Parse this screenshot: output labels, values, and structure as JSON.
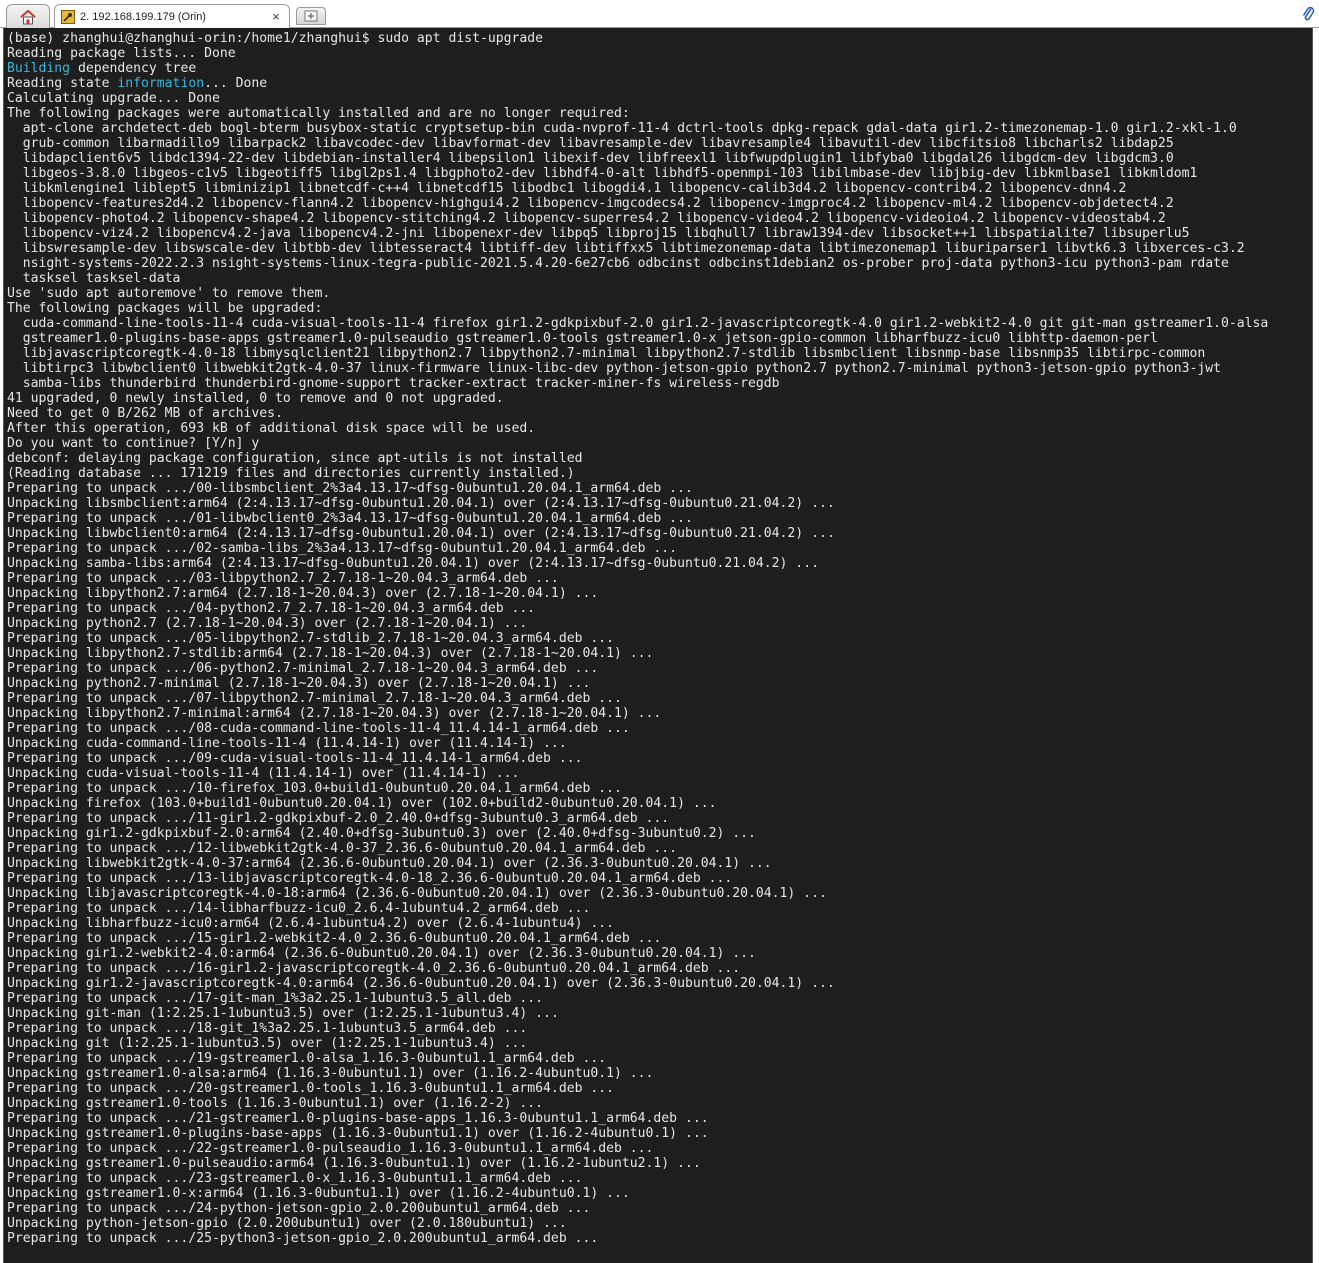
{
  "tabs": {
    "active_title": "2. 192.168.199.179 (Orin)",
    "close_glyph": "×",
    "home_icon": "home-icon",
    "new_tab_icon": "new-tab-icon"
  },
  "colors": {
    "terminal_bg": "#1e1e1e",
    "terminal_fg": "#e6e6e6",
    "highlight": "#3ab7d9"
  },
  "terminal": {
    "lines": [
      "(base) zhanghui@zhanghui-orin:/home1/zhanghui$ sudo apt dist-upgrade",
      "Reading package lists... Done",
      "Building dependency tree",
      "Reading state information... Done",
      "Calculating upgrade... Done",
      "The following packages were automatically installed and are no longer required:",
      "  apt-clone archdetect-deb bogl-bterm busybox-static cryptsetup-bin cuda-nvprof-11-4 dctrl-tools dpkg-repack gdal-data gir1.2-timezonemap-1.0 gir1.2-xkl-1.0",
      "  grub-common libarmadillo9 libarpack2 libavcodec-dev libavformat-dev libavresample-dev libavresample4 libavutil-dev libcfitsio8 libcharls2 libdap25",
      "  libdapclient6v5 libdc1394-22-dev libdebian-installer4 libepsilon1 libexif-dev libfreexl1 libfwupdplugin1 libfyba0 libgdal26 libgdcm-dev libgdcm3.0",
      "  libgeos-3.8.0 libgeos-c1v5 libgeotiff5 libgl2ps1.4 libgphoto2-dev libhdf4-0-alt libhdf5-openmpi-103 libilmbase-dev libjbig-dev libkmlbase1 libkmldom1",
      "  libkmlengine1 liblept5 libminizip1 libnetcdf-c++4 libnetcdf15 libodbc1 libogdi4.1 libopencv-calib3d4.2 libopencv-contrib4.2 libopencv-dnn4.2",
      "  libopencv-features2d4.2 libopencv-flann4.2 libopencv-highgui4.2 libopencv-imgcodecs4.2 libopencv-imgproc4.2 libopencv-ml4.2 libopencv-objdetect4.2",
      "  libopencv-photo4.2 libopencv-shape4.2 libopencv-stitching4.2 libopencv-superres4.2 libopencv-video4.2 libopencv-videoio4.2 libopencv-videostab4.2",
      "  libopencv-viz4.2 libopencv4.2-java libopencv4.2-jni libopenexr-dev libpq5 libproj15 libqhull7 libraw1394-dev libsocket++1 libspatialite7 libsuperlu5",
      "  libswresample-dev libswscale-dev libtbb-dev libtesseract4 libtiff-dev libtiffxx5 libtimezonemap-data libtimezonemap1 liburiparser1 libvtk6.3 libxerces-c3.2",
      "  nsight-systems-2022.2.3 nsight-systems-linux-tegra-public-2021.5.4.20-6e27cb6 odbcinst odbcinst1debian2 os-prober proj-data python3-icu python3-pam rdate",
      "  tasksel tasksel-data",
      "Use 'sudo apt autoremove' to remove them.",
      "The following packages will be upgraded:",
      "  cuda-command-line-tools-11-4 cuda-visual-tools-11-4 firefox gir1.2-gdkpixbuf-2.0 gir1.2-javascriptcoregtk-4.0 gir1.2-webkit2-4.0 git git-man gstreamer1.0-alsa",
      "  gstreamer1.0-plugins-base-apps gstreamer1.0-pulseaudio gstreamer1.0-tools gstreamer1.0-x jetson-gpio-common libharfbuzz-icu0 libhttp-daemon-perl",
      "  libjavascriptcoregtk-4.0-18 libmysqlclient21 libpython2.7 libpython2.7-minimal libpython2.7-stdlib libsmbclient libsnmp-base libsnmp35 libtirpc-common",
      "  libtirpc3 libwbclient0 libwebkit2gtk-4.0-37 linux-firmware linux-libc-dev python-jetson-gpio python2.7 python2.7-minimal python3-jetson-gpio python3-jwt",
      "  samba-libs thunderbird thunderbird-gnome-support tracker-extract tracker-miner-fs wireless-regdb",
      "41 upgraded, 0 newly installed, 0 to remove and 0 not upgraded.",
      "Need to get 0 B/262 MB of archives.",
      "After this operation, 693 kB of additional disk space will be used.",
      "Do you want to continue? [Y/n] y",
      "debconf: delaying package configuration, since apt-utils is not installed",
      "(Reading database ... 171219 files and directories currently installed.)",
      "Preparing to unpack .../00-libsmbclient_2%3a4.13.17~dfsg-0ubuntu1.20.04.1_arm64.deb ...",
      "Unpacking libsmbclient:arm64 (2:4.13.17~dfsg-0ubuntu1.20.04.1) over (2:4.13.17~dfsg-0ubuntu0.21.04.2) ...",
      "Preparing to unpack .../01-libwbclient0_2%3a4.13.17~dfsg-0ubuntu1.20.04.1_arm64.deb ...",
      "Unpacking libwbclient0:arm64 (2:4.13.17~dfsg-0ubuntu1.20.04.1) over (2:4.13.17~dfsg-0ubuntu0.21.04.2) ...",
      "Preparing to unpack .../02-samba-libs_2%3a4.13.17~dfsg-0ubuntu1.20.04.1_arm64.deb ...",
      "Unpacking samba-libs:arm64 (2:4.13.17~dfsg-0ubuntu1.20.04.1) over (2:4.13.17~dfsg-0ubuntu0.21.04.2) ...",
      "Preparing to unpack .../03-libpython2.7_2.7.18-1~20.04.3_arm64.deb ...",
      "Unpacking libpython2.7:arm64 (2.7.18-1~20.04.3) over (2.7.18-1~20.04.1) ...",
      "Preparing to unpack .../04-python2.7_2.7.18-1~20.04.3_arm64.deb ...",
      "Unpacking python2.7 (2.7.18-1~20.04.3) over (2.7.18-1~20.04.1) ...",
      "Preparing to unpack .../05-libpython2.7-stdlib_2.7.18-1~20.04.3_arm64.deb ...",
      "Unpacking libpython2.7-stdlib:arm64 (2.7.18-1~20.04.3) over (2.7.18-1~20.04.1) ...",
      "Preparing to unpack .../06-python2.7-minimal_2.7.18-1~20.04.3_arm64.deb ...",
      "Unpacking python2.7-minimal (2.7.18-1~20.04.3) over (2.7.18-1~20.04.1) ...",
      "Preparing to unpack .../07-libpython2.7-minimal_2.7.18-1~20.04.3_arm64.deb ...",
      "Unpacking libpython2.7-minimal:arm64 (2.7.18-1~20.04.3) over (2.7.18-1~20.04.1) ...",
      "Preparing to unpack .../08-cuda-command-line-tools-11-4_11.4.14-1_arm64.deb ...",
      "Unpacking cuda-command-line-tools-11-4 (11.4.14-1) over (11.4.14-1) ...",
      "Preparing to unpack .../09-cuda-visual-tools-11-4_11.4.14-1_arm64.deb ...",
      "Unpacking cuda-visual-tools-11-4 (11.4.14-1) over (11.4.14-1) ...",
      "Preparing to unpack .../10-firefox_103.0+build1-0ubuntu0.20.04.1_arm64.deb ...",
      "Unpacking firefox (103.0+build1-0ubuntu0.20.04.1) over (102.0+build2-0ubuntu0.20.04.1) ...",
      "Preparing to unpack .../11-gir1.2-gdkpixbuf-2.0_2.40.0+dfsg-3ubuntu0.3_arm64.deb ...",
      "Unpacking gir1.2-gdkpixbuf-2.0:arm64 (2.40.0+dfsg-3ubuntu0.3) over (2.40.0+dfsg-3ubuntu0.2) ...",
      "Preparing to unpack .../12-libwebkit2gtk-4.0-37_2.36.6-0ubuntu0.20.04.1_arm64.deb ...",
      "Unpacking libwebkit2gtk-4.0-37:arm64 (2.36.6-0ubuntu0.20.04.1) over (2.36.3-0ubuntu0.20.04.1) ...",
      "Preparing to unpack .../13-libjavascriptcoregtk-4.0-18_2.36.6-0ubuntu0.20.04.1_arm64.deb ...",
      "Unpacking libjavascriptcoregtk-4.0-18:arm64 (2.36.6-0ubuntu0.20.04.1) over (2.36.3-0ubuntu0.20.04.1) ...",
      "Preparing to unpack .../14-libharfbuzz-icu0_2.6.4-1ubuntu4.2_arm64.deb ...",
      "Unpacking libharfbuzz-icu0:arm64 (2.6.4-1ubuntu4.2) over (2.6.4-1ubuntu4) ...",
      "Preparing to unpack .../15-gir1.2-webkit2-4.0_2.36.6-0ubuntu0.20.04.1_arm64.deb ...",
      "Unpacking gir1.2-webkit2-4.0:arm64 (2.36.6-0ubuntu0.20.04.1) over (2.36.3-0ubuntu0.20.04.1) ...",
      "Preparing to unpack .../16-gir1.2-javascriptcoregtk-4.0_2.36.6-0ubuntu0.20.04.1_arm64.deb ...",
      "Unpacking gir1.2-javascriptcoregtk-4.0:arm64 (2.36.6-0ubuntu0.20.04.1) over (2.36.3-0ubuntu0.20.04.1) ...",
      "Preparing to unpack .../17-git-man_1%3a2.25.1-1ubuntu3.5_all.deb ...",
      "Unpacking git-man (1:2.25.1-1ubuntu3.5) over (1:2.25.1-1ubuntu3.4) ...",
      "Preparing to unpack .../18-git_1%3a2.25.1-1ubuntu3.5_arm64.deb ...",
      "Unpacking git (1:2.25.1-1ubuntu3.5) over (1:2.25.1-1ubuntu3.4) ...",
      "Preparing to unpack .../19-gstreamer1.0-alsa_1.16.3-0ubuntu1.1_arm64.deb ...",
      "Unpacking gstreamer1.0-alsa:arm64 (1.16.3-0ubuntu1.1) over (1.16.2-4ubuntu0.1) ...",
      "Preparing to unpack .../20-gstreamer1.0-tools_1.16.3-0ubuntu1.1_arm64.deb ...",
      "Unpacking gstreamer1.0-tools (1.16.3-0ubuntu1.1) over (1.16.2-2) ...",
      "Preparing to unpack .../21-gstreamer1.0-plugins-base-apps_1.16.3-0ubuntu1.1_arm64.deb ...",
      "Unpacking gstreamer1.0-plugins-base-apps (1.16.3-0ubuntu1.1) over (1.16.2-4ubuntu0.1) ...",
      "Preparing to unpack .../22-gstreamer1.0-pulseaudio_1.16.3-0ubuntu1.1_arm64.deb ...",
      "Unpacking gstreamer1.0-pulseaudio:arm64 (1.16.3-0ubuntu1.1) over (1.16.2-1ubuntu2.1) ...",
      "Preparing to unpack .../23-gstreamer1.0-x_1.16.3-0ubuntu1.1_arm64.deb ...",
      "Unpacking gstreamer1.0-x:arm64 (1.16.3-0ubuntu1.1) over (1.16.2-4ubuntu0.1) ...",
      "Preparing to unpack .../24-python-jetson-gpio_2.0.200ubuntu1_arm64.deb ...",
      "Unpacking python-jetson-gpio (2.0.200ubuntu1) over (2.0.180ubuntu1) ...",
      "Preparing to unpack .../25-python3-jetson-gpio_2.0.200ubuntu1_arm64.deb ..."
    ]
  }
}
